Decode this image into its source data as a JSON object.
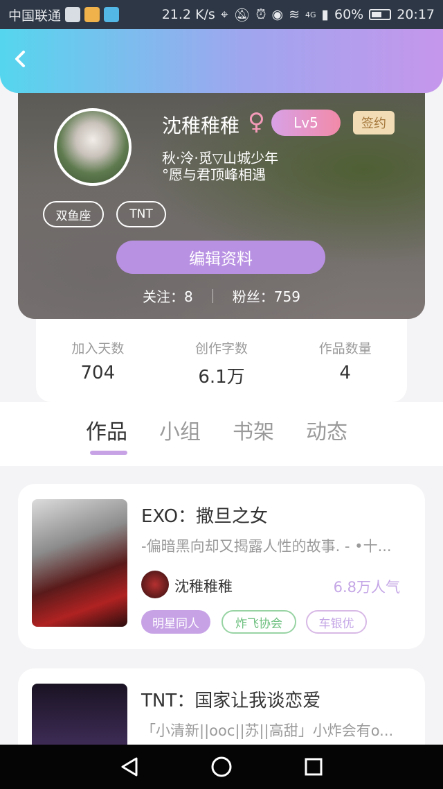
{
  "status_bar": {
    "carrier": "中国联通",
    "speed": "21.2 K/s",
    "signal": "4G",
    "battery": "60%",
    "time": "20:17"
  },
  "profile": {
    "nickname": "沈稚稚稚",
    "gender_symbol": "♀",
    "level": "Lv5",
    "signed_label": "签约",
    "bio_line1": "秋·泠·觅▽山城少年",
    "bio_line2": "°愿与君顶峰相遇",
    "tags": [
      "双鱼座",
      "TNT"
    ],
    "edit_button": "编辑资料",
    "follow_label": "关注：8",
    "fans_label": "粉丝：759"
  },
  "stats": [
    {
      "label": "加入天数",
      "value": "704"
    },
    {
      "label": "创作字数",
      "value": "6.1万"
    },
    {
      "label": "作品数量",
      "value": "4"
    }
  ],
  "tabs": [
    "作品",
    "小组",
    "书架",
    "动态"
  ],
  "active_tab": "作品",
  "works": [
    {
      "title": "EXO：撒旦之女",
      "description": "-偏暗黑向却又揭露人性的故事. - •十...",
      "author": "沈稚稚稚",
      "popularity": "6.8万人气",
      "chips": [
        "明星同人",
        "炸飞协会",
        "车银优"
      ]
    },
    {
      "title": "TNT：国家让我谈恋爱",
      "description": "「小清新||ooc||苏||高甜」小炸会有o..."
    }
  ],
  "colors": {
    "accent": "#c7a3e6",
    "header_gradient_start": "#55d6ee",
    "header_gradient_end": "#c596ec"
  },
  "icons": {
    "back": "chevron-left-icon",
    "nav_back": "triangle-back-icon",
    "nav_home": "circle-home-icon",
    "nav_recent": "square-recent-icon"
  }
}
